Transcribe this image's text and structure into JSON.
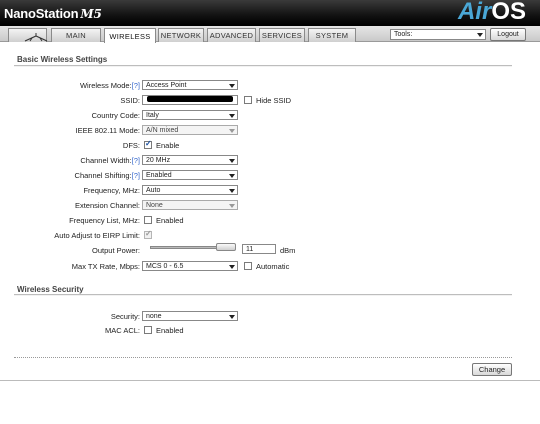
{
  "header": {
    "brand": "NanoStation",
    "model": "M5",
    "logo_air": "Air",
    "logo_os": "OS"
  },
  "tabs": [
    {
      "label": "MAIN"
    },
    {
      "label": "WIRELESS",
      "active": true
    },
    {
      "label": "NETWORK"
    },
    {
      "label": "ADVANCED"
    },
    {
      "label": "SERVICES"
    },
    {
      "label": "SYSTEM"
    }
  ],
  "toolbar": {
    "tools_value": "Tools:",
    "logout_label": "Logout"
  },
  "basic": {
    "title": "Basic Wireless Settings",
    "wireless_mode_label": "Wireless Mode:",
    "wireless_mode_help": "[?]",
    "wireless_mode_value": "Access Point",
    "ssid_label": "SSID:",
    "hide_ssid_label": "Hide SSID",
    "country_label": "Country Code:",
    "country_value": "Italy",
    "ieee_label": "IEEE 802.11 Mode:",
    "ieee_value": "A/N mixed",
    "dfs_label": "DFS:",
    "dfs_enable_label": "Enable",
    "channel_width_label": "Channel Width:",
    "channel_width_help": "[?]",
    "channel_width_value": "20 MHz",
    "channel_shifting_label": "Channel Shifting:",
    "channel_shifting_help": "[?]",
    "channel_shifting_value": "Enabled",
    "frequency_label": "Frequency, MHz:",
    "frequency_value": "Auto",
    "extension_label": "Extension Channel:",
    "extension_value": "None",
    "freq_list_label": "Frequency List, MHz:",
    "freq_list_enabled_label": "Enabled",
    "auto_eirp_label": "Auto Adjust to EIRP Limit:",
    "output_power_label": "Output Power:",
    "output_power_value": "11",
    "output_power_unit": "dBm",
    "max_tx_label": "Max TX Rate, Mbps:",
    "max_tx_value": "MCS 0 - 6.5",
    "automatic_label": "Automatic"
  },
  "security": {
    "title": "Wireless Security",
    "security_label": "Security:",
    "security_value": "none",
    "mac_acl_label": "MAC ACL:",
    "mac_acl_enabled_label": "Enabled"
  },
  "footer": {
    "change_label": "Change"
  }
}
